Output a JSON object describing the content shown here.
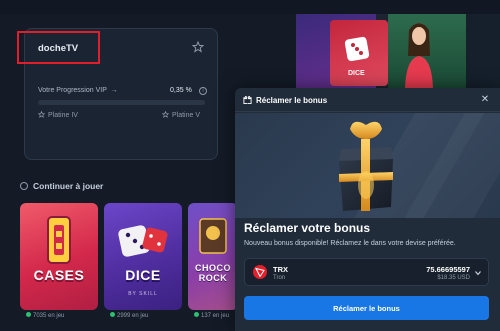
{
  "vip": {
    "username": "docheTV",
    "progress_label": "Votre Progression VIP",
    "progress_arrow": "→",
    "progress_percent": "0,35 %",
    "progress_value": 0.35,
    "current_tier": "Platine IV",
    "next_tier": "Platine V"
  },
  "continue": {
    "title": "Continuer à jouer",
    "games": [
      {
        "name": "CASES",
        "players": "7035 en jeu"
      },
      {
        "name": "DICE",
        "sub": "BY SKILL",
        "players": "2999 en jeu"
      },
      {
        "name": "CHOCO ROCK",
        "players": "137 en jeu"
      }
    ]
  },
  "promo": {
    "dice_label": "DICE"
  },
  "modal": {
    "title": "Réclamer le bonus",
    "heading": "Réclamer votre bonus",
    "description": "Nouveau bonus disponible! Réclamez le dans votre devise préférée.",
    "currency": {
      "symbol": "TRX",
      "name": "Tron",
      "amount": "75.66695597",
      "usd": "$18.35 USD"
    },
    "button_label": "Réclamer le bonus",
    "close_icon": "close-icon"
  },
  "colors": {
    "accent_blue": "#1877e5",
    "highlight_red": "#e01e2c",
    "tron_red": "#e2202b",
    "online_green": "#2fbf71"
  }
}
